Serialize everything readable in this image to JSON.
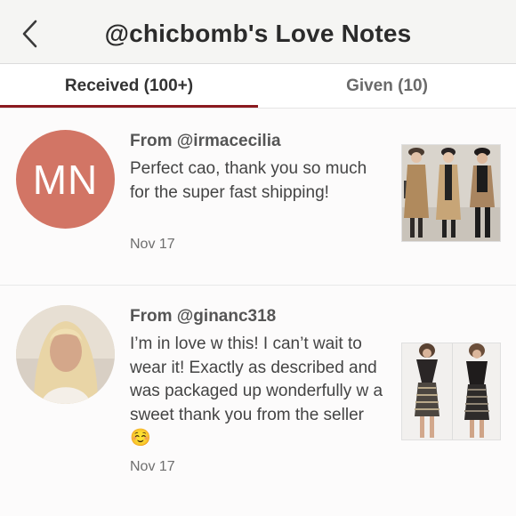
{
  "header": {
    "title": "@chicbomb's Love Notes",
    "back_icon": "chevron-left-icon"
  },
  "tabs": [
    {
      "label": "Received (100+)",
      "active": true
    },
    {
      "label": "Given (10)",
      "active": false
    }
  ],
  "colors": {
    "accent": "#8b1a1f",
    "avatar_bg": "#d27565"
  },
  "notes": [
    {
      "from": "From @irmacecilia",
      "avatar_initials": "MN",
      "message": "Perfect cao, thank you so much for the super fast shipping!",
      "date": "Nov 17"
    },
    {
      "from": "From @ginanc318",
      "avatar_initials": "",
      "message": "I’m in love w this! I can’t wait to wear it! Exactly as described and was packaged up wonderfully w a sweet thank you from the seller ☺️",
      "date": "Nov 17"
    }
  ]
}
